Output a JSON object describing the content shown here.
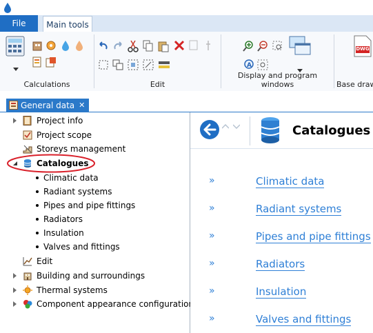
{
  "ribbon": {
    "tabs": [
      {
        "label": "File",
        "selected": false
      },
      {
        "label": "Main tools",
        "selected": true
      }
    ],
    "groups": [
      {
        "label": "Calculations"
      },
      {
        "label": "Edit"
      },
      {
        "label": "Display and program windows"
      },
      {
        "label": "Base draw"
      }
    ],
    "dwg_label": "DWG"
  },
  "document_tab": {
    "label": "General data",
    "close_glyph": "✕"
  },
  "tree": {
    "items": [
      {
        "label": "Project info",
        "icon": "book-icon",
        "level": 0,
        "expander": "collapsed"
      },
      {
        "label": "Project scope",
        "icon": "checklist-icon",
        "level": 0,
        "expander": "none"
      },
      {
        "label": "Storeys management",
        "icon": "stairs-icon",
        "level": 0,
        "expander": "none"
      },
      {
        "label": "Catalogues",
        "icon": "database-icon",
        "level": 0,
        "expander": "expanded",
        "bold": true,
        "highlighted": true
      },
      {
        "label": "Climatic data",
        "level": 1
      },
      {
        "label": "Radiant systems",
        "level": 1
      },
      {
        "label": "Pipes and pipe fittings",
        "level": 1
      },
      {
        "label": "Radiators",
        "level": 1
      },
      {
        "label": "Insulation",
        "level": 1
      },
      {
        "label": "Valves and fittings",
        "level": 1
      },
      {
        "label": "Edit",
        "icon": "edit-chart-icon",
        "level": 0,
        "expander": "none"
      },
      {
        "label": "Building and surroundings",
        "icon": "building-icon",
        "level": 0,
        "expander": "collapsed"
      },
      {
        "label": "Thermal systems",
        "icon": "sun-icon",
        "level": 0,
        "expander": "collapsed"
      },
      {
        "label": "Component appearance configuration",
        "icon": "palette-icon",
        "level": 0,
        "expander": "collapsed"
      }
    ]
  },
  "panel": {
    "title": "Catalogues",
    "arrow_glyph": "»",
    "links": [
      "Climatic data",
      "Radiant systems",
      "Pipes and pipe fittings",
      "Radiators",
      "Insulation",
      "Valves and fittings"
    ]
  },
  "colors": {
    "accent": "#2b79c9",
    "link": "#2e7fd6",
    "highlight_ellipse": "#d9202a"
  }
}
